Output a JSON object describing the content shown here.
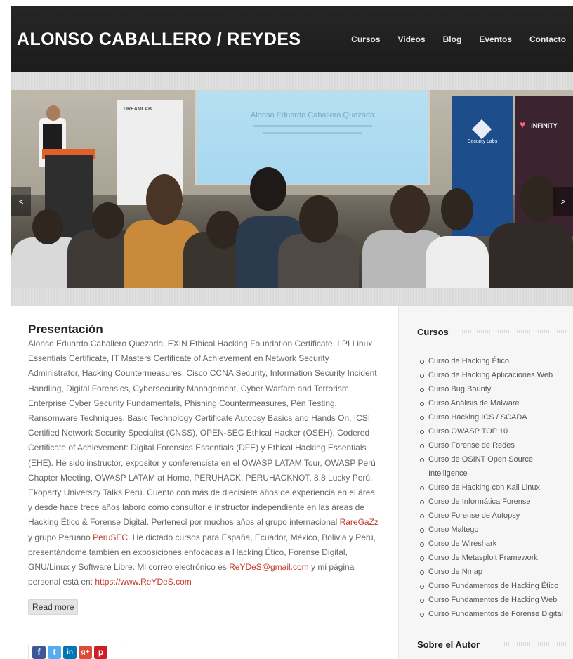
{
  "header": {
    "site_title": "ALONSO CABALLERO / REYDES",
    "nav": [
      "Cursos",
      "Videos",
      "Blog",
      "Eventos",
      "Contacto"
    ]
  },
  "slider": {
    "prev_label": "<",
    "next_label": ">",
    "projection_title": "Alonso Eduardo Caballero Quezada",
    "banner_blue_text": "Security Labs",
    "banner_dark_text": "INFINITY",
    "dreamlab_text": "DREAMLAB"
  },
  "post": {
    "title": "Presentación",
    "body_part1": "Alonso Eduardo Caballero Quezada. EXIN Ethical Hacking Foundation Certificate, LPI Linux Essentials Certificate, IT Masters Certificate of Achievement en Network Security Administrator, Hacking Countermeasures, Cisco CCNA Security, Information Security Incident Handling, Digital Forensics, Cybersecurity Management, Cyber Warfare and Terrorism, Enterprise Cyber Security Fundamentals, Phishing Countermeasures, Pen Testing, Ransomware Techniques, Basic Technology Certificate Autopsy Basics and Hands On, ICSI Certified Network Security Specialist (CNSS), OPEN-SEC Ethical Hacker (OSEH), Codered Certificate of Achievement: Digital Forensics Essentials (DFE) y Ethical Hacking Essentials (EHE). He sido instructor, expositor y conferencista en el OWASP LATAM Tour, OWASP Perú Chapter Meeting, OWASP LATAM at Home, PERUHACK, PERUHACKNOT, 8.8 Lucky Perú, Ekoparty University Talks Perú. Cuento con más de diecisiete años de experiencia en el área y desde hace trece años laboro como consultor e instructor independiente en las áreas de Hacking Ético & Forense Digital. Pertenecí por muchos años al grupo internacional ",
    "link_raregazz": "RareGaZz",
    "body_part2": " y grupo Peruano ",
    "link_perusec": "PeruSEC",
    "body_part3": ". He dictado cursos para España, Ecuador, México, Bolivia y Perú, presentándome también en exposiciones enfocadas a Hacking Ético, Forense Digital, GNU/Linux y Software Libre. Mi correo electrónico es ",
    "link_email": "ReYDeS@gmail.com",
    "body_part4": " y mi página personal está en: ",
    "link_site": "https://www.ReYDeS.com",
    "read_more": "Read more"
  },
  "share": {
    "facebook": "f",
    "twitter": "t",
    "linkedin": "in",
    "googleplus": "g+",
    "pinterest": "p",
    "colors": {
      "facebook": "#3b5998",
      "twitter": "#55acee",
      "linkedin": "#0077b5",
      "googleplus": "#dd4b39",
      "pinterest": "#cb2027"
    }
  },
  "sidebar": {
    "cursos_title": "Cursos",
    "courses": [
      "Curso de Hacking Ético",
      "Curso de Hacking Aplicaciones Web",
      "Curso Bug Bounty",
      "Curso Análisis de Malware",
      "Curso Hacking ICS / SCADA",
      "Curso OWASP TOP 10",
      "Curso Forense de Redes",
      "Curso de OSINT Open Source Intelligence",
      "Curso de Hacking con Kali Linux",
      "Curso de Informática Forense",
      "Curso Forense de Autopsy",
      "Curso Maltego",
      "Curso de Wireshark",
      "Curso de Metasploit Framework",
      "Curso de Nmap",
      "Curso Fundamentos de Hacking Ético",
      "Curso Fundamentos de Hacking Web",
      "Curso Fundamentos de Forense Digital"
    ],
    "autor_title": "Sobre el Autor"
  }
}
